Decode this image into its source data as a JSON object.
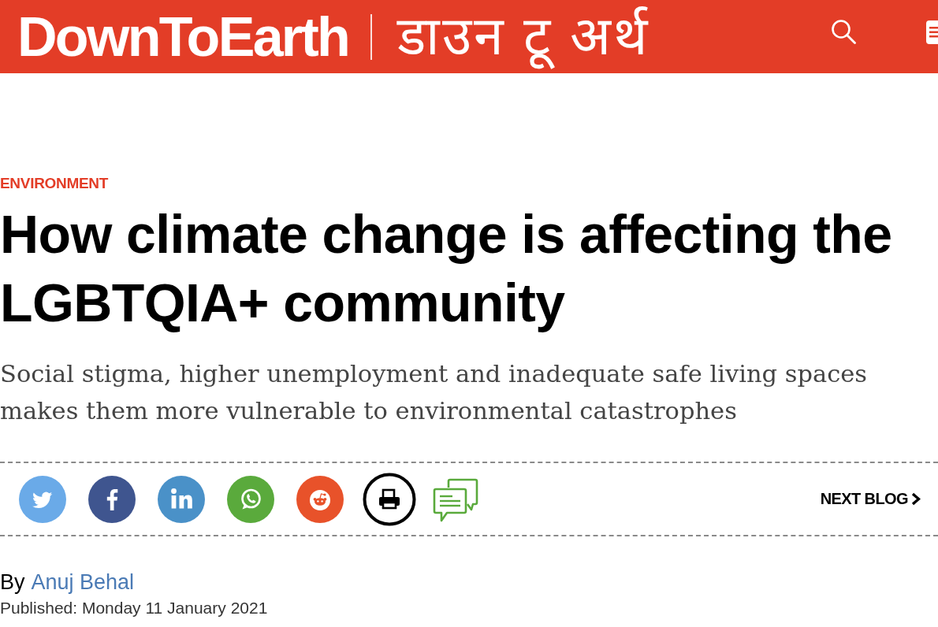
{
  "header": {
    "logo": "DownToEarth",
    "logo_hindi": "डाउन टू अर्थ"
  },
  "article": {
    "category": "ENVIRONMENT",
    "title": "How climate change is affecting the LGBTQIA+ community",
    "subtitle": "Social stigma, higher unemployment and inadequate safe living spaces makes them more vulnerable to environmental catastrophes",
    "next_link": "NEXT BLOG",
    "byline": {
      "prefix": "By",
      "author": "Anuj Behal"
    },
    "published": "Published: Monday 11 January 2021"
  }
}
